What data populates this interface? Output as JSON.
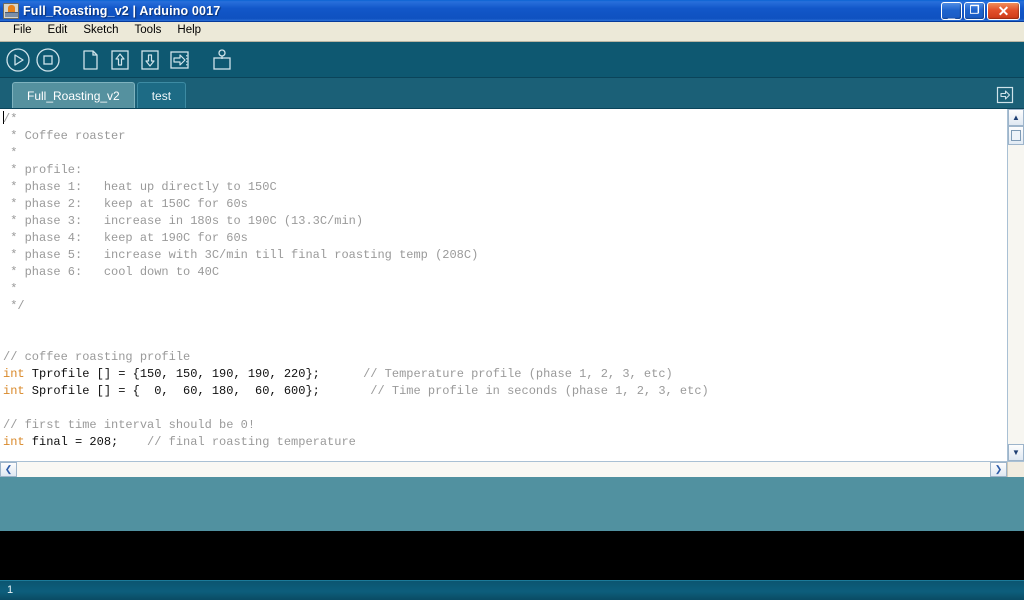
{
  "window": {
    "title": "Full_Roasting_v2 | Arduino 0017",
    "icon": "arduino-app-icon",
    "buttons": {
      "minimize": "_",
      "maximize": "❐",
      "close": "✕"
    }
  },
  "menubar": {
    "items": [
      {
        "label": "File",
        "name": "menu-file"
      },
      {
        "label": "Edit",
        "name": "menu-edit"
      },
      {
        "label": "Sketch",
        "name": "menu-sketch"
      },
      {
        "label": "Tools",
        "name": "menu-tools"
      },
      {
        "label": "Help",
        "name": "menu-help"
      }
    ]
  },
  "toolbar": {
    "buttons": [
      {
        "icon": "verify-play-icon",
        "name": "toolbar-verify",
        "tooltip": "Verify"
      },
      {
        "icon": "stop-square-icon",
        "name": "toolbar-stop",
        "tooltip": "Stop"
      },
      {
        "icon": "new-page-icon",
        "name": "toolbar-new",
        "tooltip": "New"
      },
      {
        "icon": "open-up-arrow-icon",
        "name": "toolbar-open",
        "tooltip": "Open"
      },
      {
        "icon": "save-down-arrow-icon",
        "name": "toolbar-save",
        "tooltip": "Save"
      },
      {
        "icon": "upload-right-arrow-icon",
        "name": "toolbar-upload",
        "tooltip": "Upload"
      },
      {
        "icon": "serial-monitor-icon",
        "name": "toolbar-serial-monitor",
        "tooltip": "Serial Monitor"
      }
    ]
  },
  "tabs": {
    "items": [
      {
        "label": "Full_Roasting_v2",
        "active": true
      },
      {
        "label": "test",
        "active": false
      }
    ],
    "menu_icon": "tab-menu-arrow-icon"
  },
  "editor": {
    "lines": [
      {
        "caret": true,
        "segments": [
          {
            "type": "cmt",
            "text": "/*"
          }
        ]
      },
      {
        "segments": [
          {
            "type": "cmt",
            "text": " * Coffee roaster"
          }
        ]
      },
      {
        "segments": [
          {
            "type": "cmt",
            "text": " *"
          }
        ]
      },
      {
        "segments": [
          {
            "type": "cmt",
            "text": " * profile:"
          }
        ]
      },
      {
        "segments": [
          {
            "type": "cmt",
            "text": " * phase 1:   heat up directly to 150C"
          }
        ]
      },
      {
        "segments": [
          {
            "type": "cmt",
            "text": " * phase 2:   keep at 150C for 60s"
          }
        ]
      },
      {
        "segments": [
          {
            "type": "cmt",
            "text": " * phase 3:   increase in 180s to 190C (13.3C/min)"
          }
        ]
      },
      {
        "segments": [
          {
            "type": "cmt",
            "text": " * phase 4:   keep at 190C for 60s"
          }
        ]
      },
      {
        "segments": [
          {
            "type": "cmt",
            "text": " * phase 5:   increase with 3C/min till final roasting temp (208C)"
          }
        ]
      },
      {
        "segments": [
          {
            "type": "cmt",
            "text": " * phase 6:   cool down to 40C"
          }
        ]
      },
      {
        "segments": [
          {
            "type": "cmt",
            "text": " *"
          }
        ]
      },
      {
        "segments": [
          {
            "type": "cmt",
            "text": " */"
          }
        ]
      },
      {
        "segments": [
          {
            "type": "txt",
            "text": ""
          }
        ]
      },
      {
        "segments": [
          {
            "type": "txt",
            "text": ""
          }
        ]
      },
      {
        "segments": [
          {
            "type": "cmt",
            "text": "// coffee roasting profile"
          }
        ]
      },
      {
        "segments": [
          {
            "type": "kw",
            "text": "int"
          },
          {
            "type": "txt",
            "text": " Tprofile [] = {150, 150, 190, 190, 220};      "
          },
          {
            "type": "cmt",
            "text": "// Temperature profile (phase 1, 2, 3, etc)"
          }
        ]
      },
      {
        "segments": [
          {
            "type": "kw",
            "text": "int"
          },
          {
            "type": "txt",
            "text": " Sprofile [] = {  0,  60, 180,  60, 600};       "
          },
          {
            "type": "cmt",
            "text": "// Time profile in seconds (phase 1, 2, 3, etc)"
          }
        ]
      },
      {
        "segments": [
          {
            "type": "txt",
            "text": ""
          }
        ]
      },
      {
        "segments": [
          {
            "type": "cmt",
            "text": "// first time interval should be 0!"
          }
        ]
      },
      {
        "segments": [
          {
            "type": "kw",
            "text": "int"
          },
          {
            "type": "txt",
            "text": " final = 208;    "
          },
          {
            "type": "cmt",
            "text": "// final roasting temperature"
          }
        ]
      }
    ]
  },
  "scrollbars": {
    "vertical": {
      "up": "▲",
      "down": "▼",
      "thumb": "scroll-thumb"
    },
    "horizontal": {
      "left": "❮",
      "right": "❯"
    }
  },
  "statusbar": {
    "line_number": "1"
  },
  "colors": {
    "titlebar_blue": "#1257c9",
    "menubar_bg": "#ece9d8",
    "toolbar_bg": "#0e5871",
    "tabbar_bg": "#1b6077",
    "tab_active_bg": "#55919f",
    "editor_bg": "#ffffff",
    "comment_gray": "#9a9a9a",
    "keyword_orange": "#d9892a",
    "status_teal": "#5191a0",
    "console_black": "#000000",
    "statusbar_bg": "#0d5e7c"
  }
}
